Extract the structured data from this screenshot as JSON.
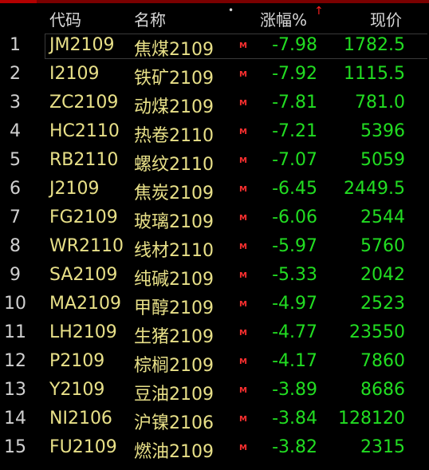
{
  "header": {
    "code": "代码",
    "name": "名称",
    "dot": "•",
    "change": "涨幅%",
    "sort_arrow": "↑",
    "price": "现价"
  },
  "rows": [
    {
      "idx": "1",
      "code": "JM2109",
      "name": "焦煤2109",
      "mark": "M",
      "change": "-7.98",
      "price": "1782.5"
    },
    {
      "idx": "2",
      "code": "I2109",
      "name": "铁矿2109",
      "mark": "M",
      "change": "-7.92",
      "price": "1115.5"
    },
    {
      "idx": "3",
      "code": "ZC2109",
      "name": "动煤2109",
      "mark": "M",
      "change": "-7.81",
      "price": "781.0"
    },
    {
      "idx": "4",
      "code": "HC2110",
      "name": "热卷2110",
      "mark": "M",
      "change": "-7.21",
      "price": "5396"
    },
    {
      "idx": "5",
      "code": "RB2110",
      "name": "螺纹2110",
      "mark": "M",
      "change": "-7.07",
      "price": "5059"
    },
    {
      "idx": "6",
      "code": "J2109",
      "name": "焦炭2109",
      "mark": "M",
      "change": "-6.45",
      "price": "2449.5"
    },
    {
      "idx": "7",
      "code": "FG2109",
      "name": "玻璃2109",
      "mark": "M",
      "change": "-6.06",
      "price": "2544"
    },
    {
      "idx": "8",
      "code": "WR2110",
      "name": "线材2110",
      "mark": "M",
      "change": "-5.97",
      "price": "5760"
    },
    {
      "idx": "9",
      "code": "SA2109",
      "name": "纯碱2109",
      "mark": "M",
      "change": "-5.33",
      "price": "2042"
    },
    {
      "idx": "10",
      "code": "MA2109",
      "name": "甲醇2109",
      "mark": "M",
      "change": "-4.97",
      "price": "2523"
    },
    {
      "idx": "11",
      "code": "LH2109",
      "name": "生猪2109",
      "mark": "M",
      "change": "-4.77",
      "price": "23550"
    },
    {
      "idx": "12",
      "code": "P2109",
      "name": "棕榈2109",
      "mark": "M",
      "change": "-4.17",
      "price": "7860"
    },
    {
      "idx": "13",
      "code": "Y2109",
      "name": "豆油2109",
      "mark": "M",
      "change": "-3.89",
      "price": "8686"
    },
    {
      "idx": "14",
      "code": "NI2106",
      "name": "沪镍2106",
      "mark": "M",
      "change": "-3.84",
      "price": "128120"
    },
    {
      "idx": "15",
      "code": "FU2109",
      "name": "燃油2109",
      "mark": "M",
      "change": "-3.82",
      "price": "2315"
    }
  ],
  "colors": {
    "background": "#000000",
    "code_name": "#e8e088",
    "change_price": "#22dd22",
    "mark": "#ff3030",
    "sort_arrow": "#ff2020"
  }
}
